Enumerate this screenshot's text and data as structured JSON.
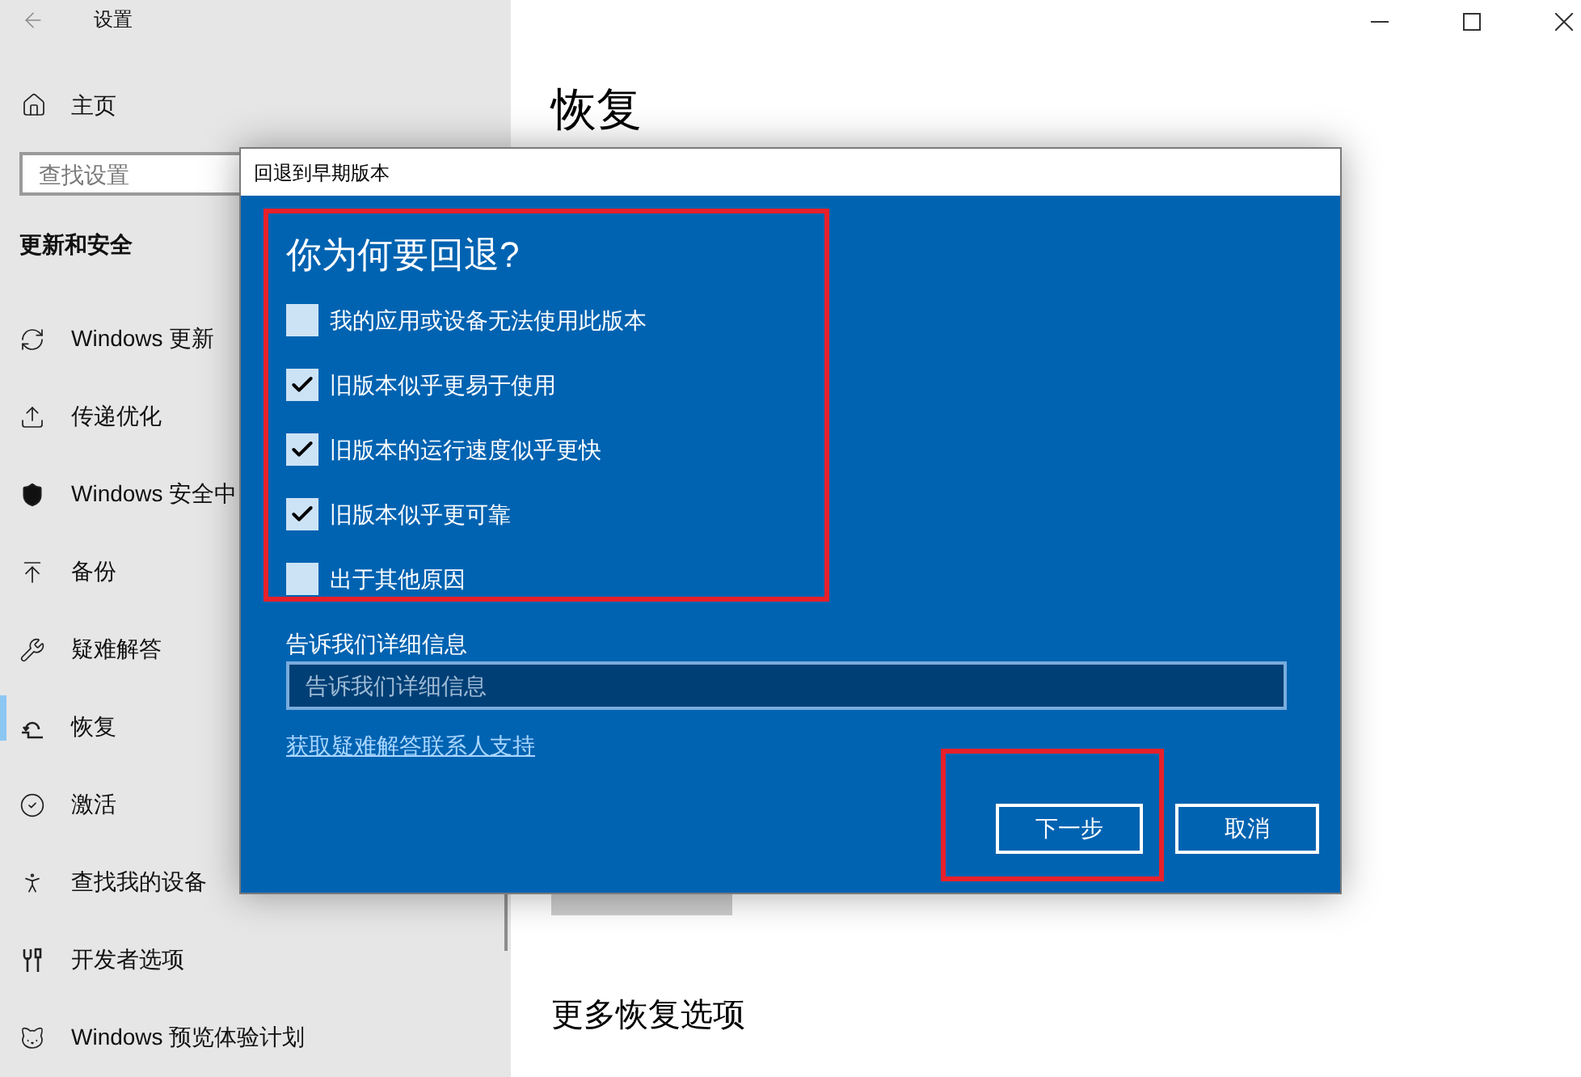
{
  "window": {
    "title": "设置"
  },
  "sidebar": {
    "home": "主页",
    "search": {
      "placeholder": "查找设置"
    },
    "section_title": "更新和安全",
    "items": [
      {
        "label": "Windows 更新",
        "selected": false
      },
      {
        "label": "传递优化",
        "selected": false
      },
      {
        "label": "Windows 安全中",
        "selected": false
      },
      {
        "label": "备份",
        "selected": false
      },
      {
        "label": "疑难解答",
        "selected": false
      },
      {
        "label": "恢复",
        "selected": true
      },
      {
        "label": "激活",
        "selected": false
      },
      {
        "label": "查找我的设备",
        "selected": false
      },
      {
        "label": "开发者选项",
        "selected": false
      },
      {
        "label": "Windows 预览体验计划",
        "selected": false
      }
    ]
  },
  "page": {
    "title": "恢复",
    "more_options_title": "更多恢复选项"
  },
  "dialog": {
    "title": "回退到早期版本",
    "heading": "你为何要回退?",
    "reasons_highlighted": true,
    "reasons": [
      {
        "label": "我的应用或设备无法使用此版本",
        "checked": false
      },
      {
        "label": "旧版本似乎更易于使用",
        "checked": true
      },
      {
        "label": "旧版本的运行速度似乎更快",
        "checked": true
      },
      {
        "label": "旧版本似乎更可靠",
        "checked": true
      },
      {
        "label": "出于其他原因",
        "checked": false
      }
    ],
    "details": {
      "label": "告诉我们详细信息",
      "placeholder": "告诉我们详细信息"
    },
    "support_link": "获取疑难解答联系人支持",
    "buttons": [
      {
        "label": "下一步",
        "highlighted": true
      },
      {
        "label": "取消",
        "highlighted": false
      }
    ]
  }
}
